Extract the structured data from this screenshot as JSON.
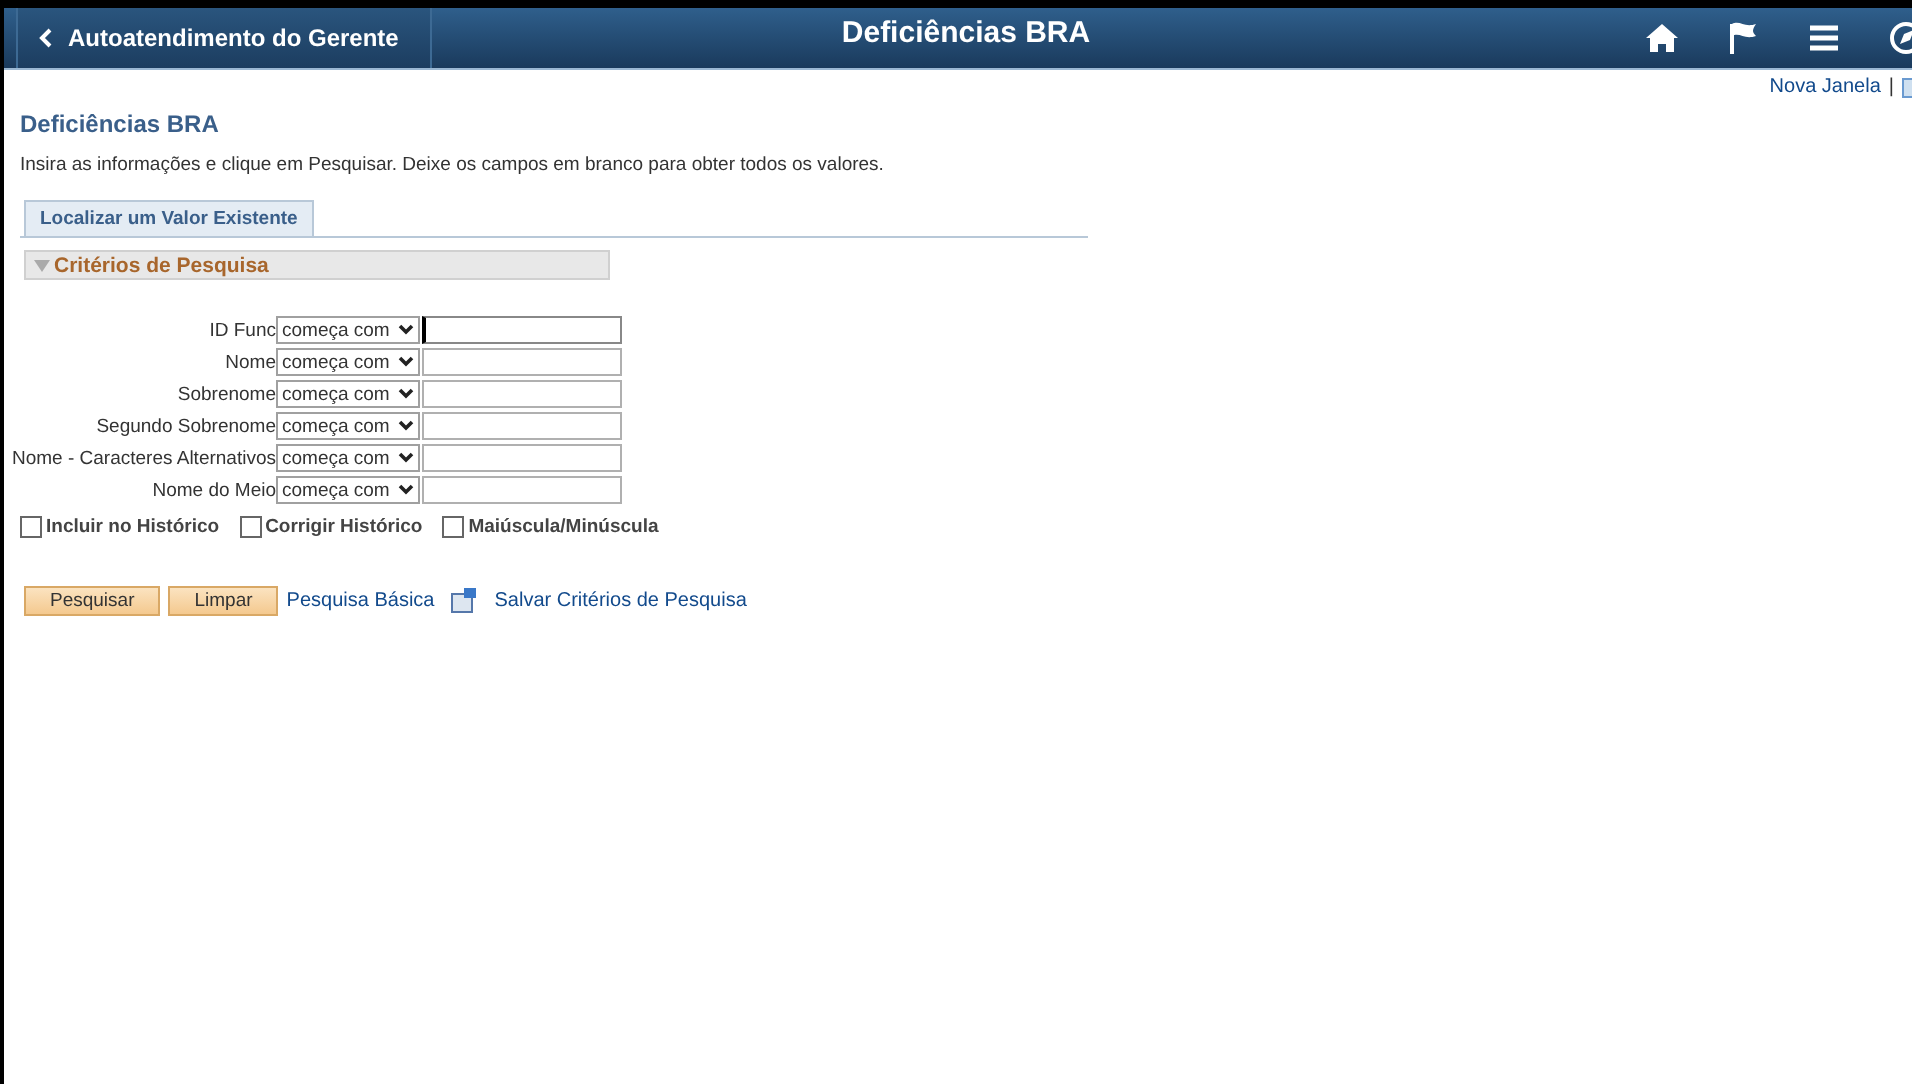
{
  "header": {
    "back_label": "Autoatendimento do Gerente",
    "title": "Deficiências BRA"
  },
  "top_links": {
    "new_window": "Nova Janela",
    "separator": "|"
  },
  "page": {
    "title": "Deficiências BRA",
    "instructions": "Insira as informações e clique em Pesquisar. Deixe os campos em branco para obter todos os valores."
  },
  "tabs": [
    {
      "label": "Localizar um Valor Existente",
      "selected": true
    }
  ],
  "section": {
    "title": "Critérios de Pesquisa",
    "expanded": true
  },
  "fields": [
    {
      "label": "ID Func",
      "operator": "começa com",
      "focused": true
    },
    {
      "label": "Nome",
      "operator": "começa com",
      "focused": false
    },
    {
      "label": "Sobrenome",
      "operator": "começa com",
      "focused": false
    },
    {
      "label": "Segundo Sobrenome",
      "operator": "começa com",
      "focused": false
    },
    {
      "label": "Nome - Caracteres Alternativos",
      "operator": "começa com",
      "focused": false
    },
    {
      "label": "Nome do Meio",
      "operator": "começa com",
      "focused": false
    }
  ],
  "options": [
    {
      "label": "Incluir no Histórico",
      "checked": false
    },
    {
      "label": "Corrigir Histórico",
      "checked": false
    },
    {
      "label": "Maiúscula/Minúscula",
      "checked": false
    }
  ],
  "buttons": [
    "Pesquisar",
    "Limpar"
  ],
  "links": [
    {
      "label": "Pesquisa Básica",
      "kind": "plain"
    },
    {
      "label": "Salvar Critérios de Pesquisa",
      "kind": "icon"
    }
  ]
}
